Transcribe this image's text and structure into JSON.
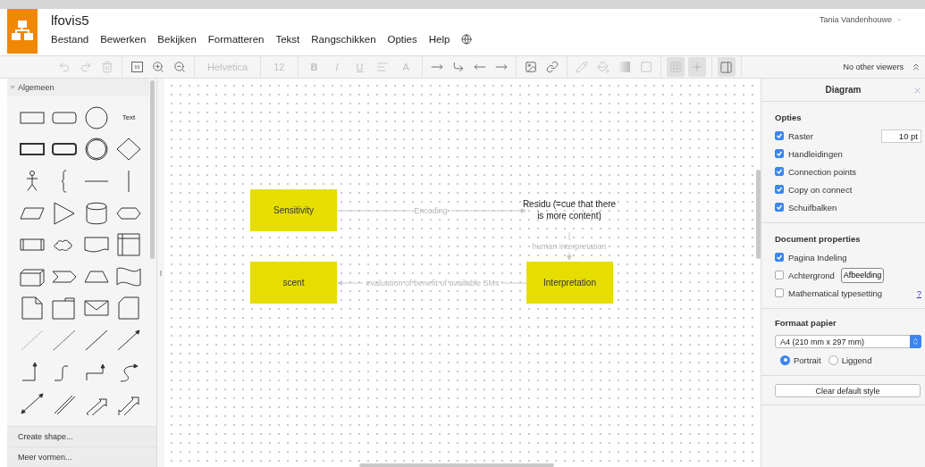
{
  "header": {
    "title": "lfovis5",
    "user": "Tania Vandenhouwe",
    "menu": [
      "Bestand",
      "Bewerken",
      "Bekijken",
      "Formatteren",
      "Tekst",
      "Rangschikken",
      "Opties",
      "Help"
    ]
  },
  "toolbar": {
    "font": {
      "value": "Helvetica",
      "disabled": true
    },
    "font_size": {
      "value": "12",
      "disabled": true
    },
    "format_buttons": [
      {
        "kind": "glyph",
        "label": "B",
        "disabled": true
      },
      {
        "kind": "glyph",
        "label": "I",
        "disabled": true
      },
      {
        "kind": "glyph",
        "label": "U",
        "disabled": true
      },
      {
        "kind": "align",
        "disabled": true
      },
      {
        "kind": "glyph",
        "label": "A",
        "disabled": true
      }
    ],
    "toggles": [
      {
        "selected": true
      },
      {
        "selected": true
      },
      {
        "selected": true
      }
    ],
    "viewers": "No other viewers"
  },
  "sidebar": {
    "section": {
      "title": "Algemeen",
      "expanded": true
    },
    "text_shape_label": "Text",
    "footer": [
      "Create shape...",
      "Meer vormen..."
    ]
  },
  "diagram": {
    "nodes": [
      {
        "kind": "box",
        "label": "Sensitivity"
      },
      {
        "kind": "box",
        "label": "scent"
      },
      {
        "kind": "text",
        "label": "Residu (=cue that there is more content)"
      },
      {
        "kind": "box",
        "label": "Interpretation"
      }
    ],
    "edges": [
      {
        "label": "Encoding"
      },
      {
        "label": "human interpretation"
      },
      {
        "label": "evaluation of benefit of available SMs"
      }
    ]
  },
  "format_panel": {
    "title": "Diagram",
    "sections": [
      {
        "kind": "checklist",
        "title": "Opties",
        "items": [
          {
            "label": "Raster",
            "checked": true,
            "field": "10 pt"
          },
          {
            "label": "Handleidingen",
            "checked": true
          },
          {
            "label": "Connection points",
            "checked": true
          },
          {
            "label": "Copy on connect",
            "checked": true
          },
          {
            "label": "Schuifbalken",
            "checked": true
          }
        ]
      },
      {
        "kind": "checklist",
        "title": "Document properties",
        "items": [
          {
            "label": "Pagina Indeling",
            "checked": true
          },
          {
            "label": "Achtergrond",
            "checked": false,
            "button": "Afbeelding"
          },
          {
            "label": "Mathematical typesetting",
            "checked": false,
            "link": "?"
          }
        ]
      },
      {
        "kind": "paper",
        "title": "Formaat papier",
        "select": "A4 (210 mm x 297 mm)",
        "radios": [
          {
            "label": "Portrait",
            "selected": true
          },
          {
            "label": "Liggend",
            "selected": false
          }
        ]
      },
      {
        "kind": "button",
        "label": "Clear default style"
      }
    ]
  }
}
